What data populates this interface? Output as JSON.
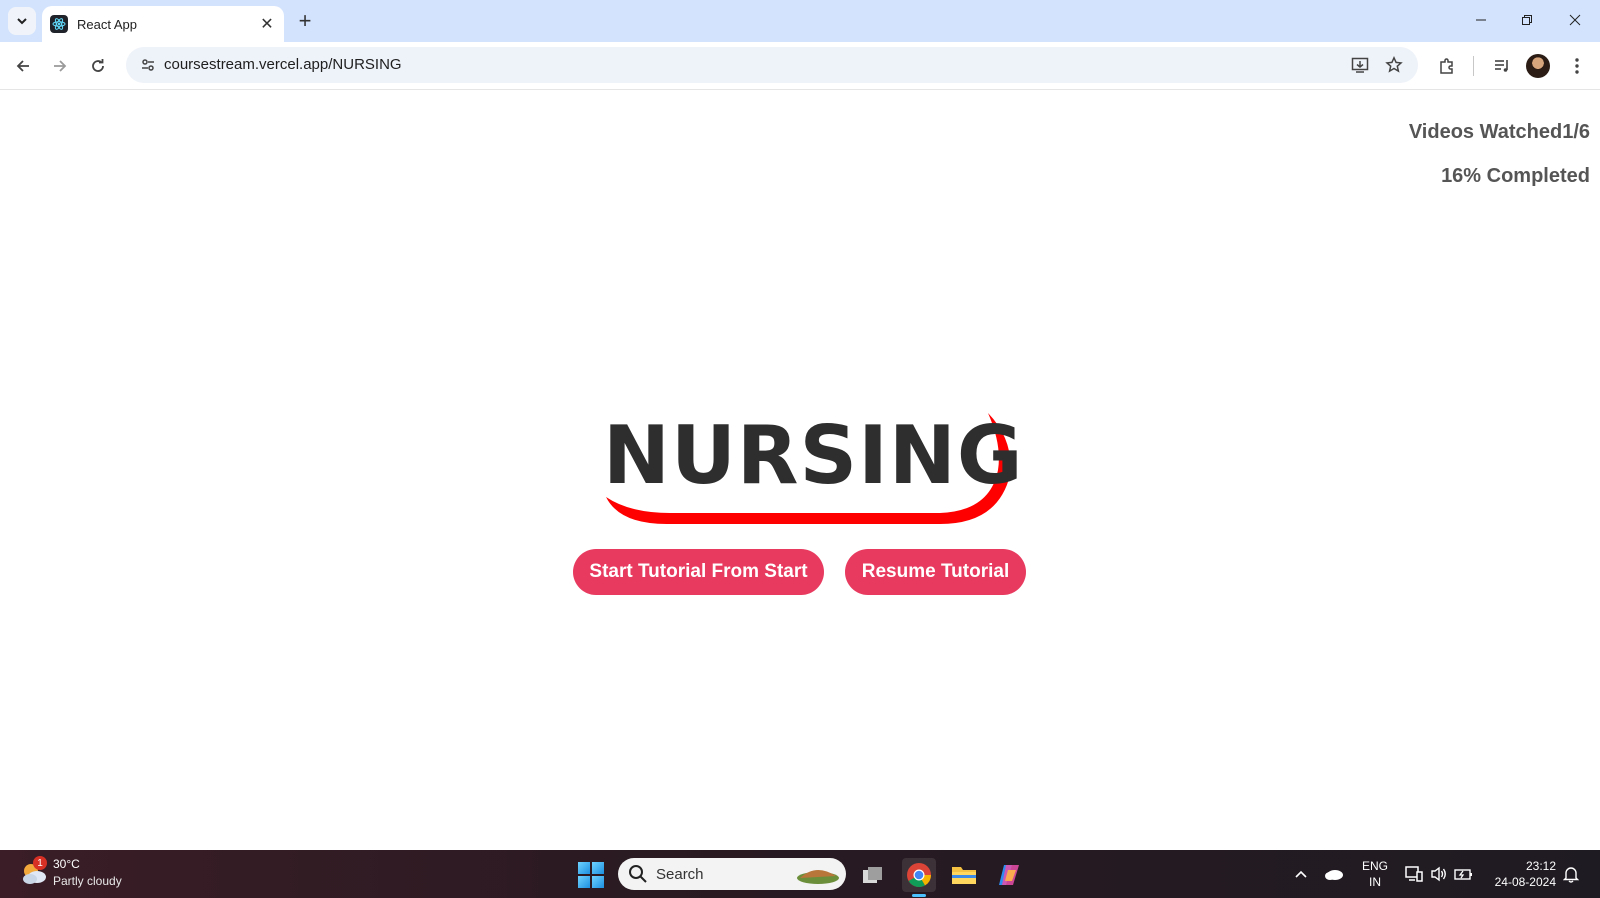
{
  "browser": {
    "tab_title": "React App",
    "url": "coursestream.vercel.app/NURSING"
  },
  "page": {
    "videos_watched_label": "Videos Watched1/6",
    "completed_label": "16% Completed",
    "course_title": "NURSING",
    "start_button": "Start Tutorial From Start",
    "resume_button": "Resume Tutorial",
    "progress": {
      "watched": 1,
      "total": 6,
      "percent": 16
    },
    "colors": {
      "accent": "#e83a5f",
      "swoosh": "#ff0000",
      "title": "#2e2e2e"
    }
  },
  "taskbar": {
    "weather_temp": "30°C",
    "weather_desc": "Partly cloudy",
    "weather_badge": "1",
    "search_label": "Search",
    "lang_line1": "ENG",
    "lang_line2": "IN",
    "time": "23:12",
    "date": "24-08-2024"
  }
}
